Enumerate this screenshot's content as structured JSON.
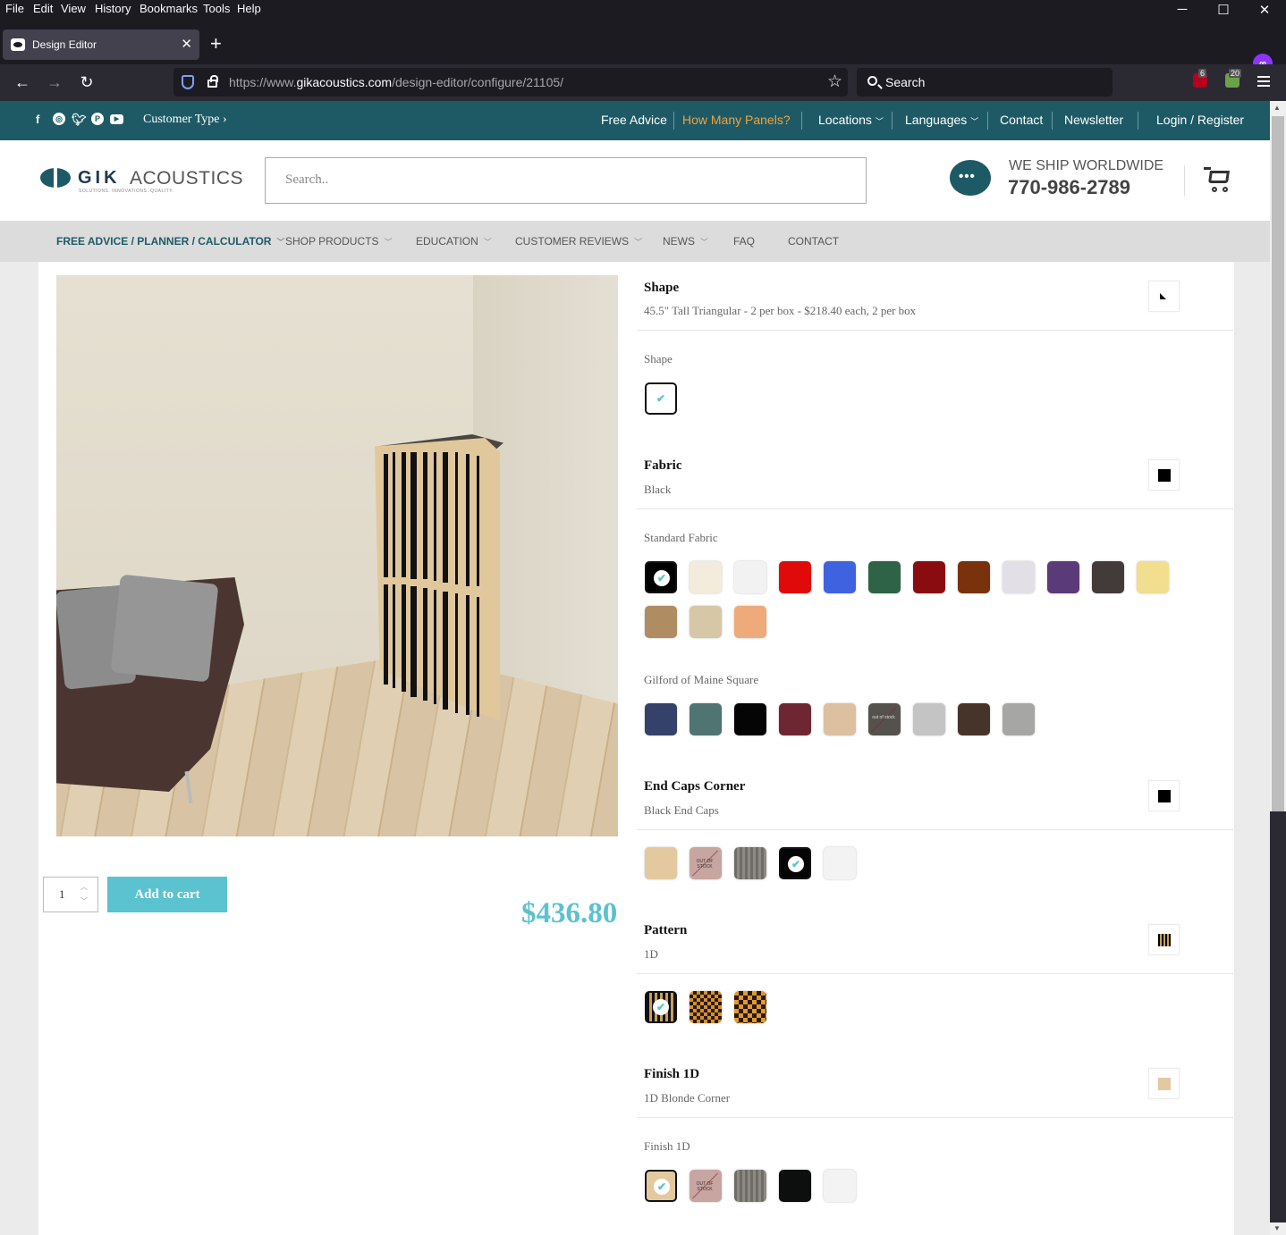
{
  "browser": {
    "menu": [
      "File",
      "Edit",
      "View",
      "History",
      "Bookmarks",
      "Tools",
      "Help"
    ],
    "tab_title": "Design Editor",
    "url_prefix": "https://www.",
    "url_domain": "gikacoustics.com",
    "url_path": "/design-editor/configure/21105/",
    "search_placeholder": "Search",
    "ext_badge_1": "6",
    "ext_badge_2": "20"
  },
  "topbar": {
    "customer_type": "Customer Type ›",
    "links": [
      "Free Advice",
      "How Many Panels?",
      "Locations",
      "Languages",
      "Contact",
      "Newsletter",
      "Login / Register"
    ]
  },
  "header": {
    "logo_gik": "GIK",
    "logo_acoustics": "ACOUSTICS",
    "logo_tagline": "SOLUTIONS. INNOVATIONS. QUALITY.",
    "search_placeholder": "Search..",
    "ship_text": "WE SHIP WORLDWIDE",
    "phone": "770-986-2789"
  },
  "mainnav": [
    "FREE ADVICE / PLANNER / CALCULATOR",
    "SHOP PRODUCTS",
    "EDUCATION",
    "CUSTOMER REVIEWS",
    "NEWS",
    "FAQ",
    "CONTACT"
  ],
  "product": {
    "quantity": "1",
    "add_to_cart": "Add to cart",
    "price": "$436.80"
  },
  "options": {
    "shape": {
      "title": "Shape",
      "value": "45.5\" Tall Triangular - 2 per box - $218.40 each, 2 per box",
      "sub": "Shape"
    },
    "fabric": {
      "title": "Fabric",
      "value": "Black",
      "group1": "Standard Fabric",
      "group1_colors": [
        "#000000",
        "#f3ebdc",
        "#f2f2f2",
        "#e00a0a",
        "#3f63e0",
        "#2e6347",
        "#8a0c10",
        "#78320c",
        "#e2e0e6",
        "#5a3a78",
        "#433b3a",
        "#f1de8e",
        "#b08c62",
        "#d6c7a6",
        "#eeaa7a"
      ],
      "group2": "Gilford of Maine Square",
      "group2_colors": [
        "#34416a",
        "#4f7472",
        "#050505",
        "#6e2732",
        "#dcc0a0",
        "#55524e",
        "#c4c4c4",
        "#46342a",
        "#a6a6a4"
      ],
      "out_of_stock": "out of stock"
    },
    "endcaps": {
      "title": "End Caps Corner",
      "value": "Black End Caps",
      "colors": [
        "#e4c9a0",
        "#c7a5a0",
        "#7d7974",
        "#050505",
        "#f3f3f3"
      ],
      "out_of_stock": "OUT OF STOCK"
    },
    "pattern": {
      "title": "Pattern",
      "value": "1D"
    },
    "finish": {
      "title": "Finish 1D",
      "value": "1D Blonde Corner",
      "sub": "Finish 1D",
      "colors": [
        "#e4c9a0",
        "#c7a5a0",
        "#7d7974",
        "#0c0f0e",
        "#f3f3f3"
      ],
      "out_of_stock": "OUT OF STOCK"
    }
  }
}
